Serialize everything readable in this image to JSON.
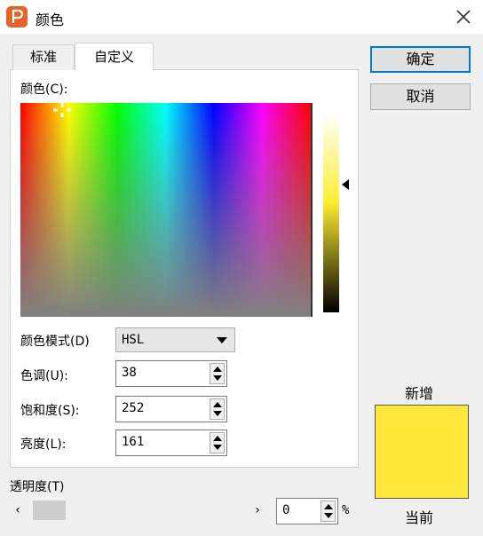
{
  "window": {
    "title": "颜色"
  },
  "tabs": [
    {
      "label": "标准"
    },
    {
      "label": "自定义"
    }
  ],
  "custom": {
    "color_label": "颜色(C):",
    "mode_label": "颜色模式(D)",
    "mode_value": "HSL",
    "hue_label": "色调(U):",
    "hue_value": "38",
    "saturation_label": "饱和度(S):",
    "saturation_value": "252",
    "luminance_label": "亮度(L):",
    "luminance_value": "161",
    "transparency_label": "透明度(T)",
    "transparency_value": "0",
    "transparency_unit": "%",
    "transparency_level": 0
  },
  "buttons": {
    "ok": "确定",
    "cancel": "取消"
  },
  "preview": {
    "new_label": "新增",
    "current_label": "当前",
    "color": "#ffe83a"
  },
  "colors": {
    "accent": "#0078d7",
    "app_icon": "#e8632b"
  },
  "icons": [
    "app-logo-icon",
    "close-icon",
    "crosshair-icon",
    "triangle-left-icon",
    "chevron-down-icon",
    "chevron-left-icon",
    "chevron-right-icon",
    "spin-up-icon",
    "spin-down-icon"
  ]
}
